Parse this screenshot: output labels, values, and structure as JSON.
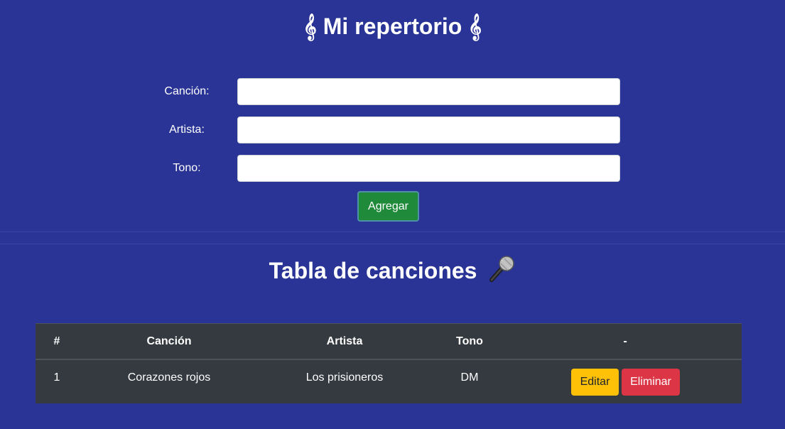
{
  "header": {
    "title": "𝄞 Mi repertorio 𝄞"
  },
  "form": {
    "song_label": "Canción:",
    "song_value": "",
    "artist_label": "Artista:",
    "artist_value": "",
    "key_label": "Tono:",
    "key_value": "",
    "add_button": "Agregar"
  },
  "table_section": {
    "title": "Tabla de canciones",
    "title_icon": "microphone-icon",
    "columns": [
      "#",
      "Canción",
      "Artista",
      "Tono",
      "-"
    ],
    "rows": [
      {
        "num": "1",
        "song": "Corazones rojos",
        "artist": "Los prisioneros",
        "key": "DM",
        "edit_label": "Editar",
        "delete_label": "Eliminar"
      }
    ]
  },
  "colors": {
    "background": "#293496",
    "add_button": "#1f8a3a",
    "edit_button": "#ffc107",
    "delete_button": "#dc3545",
    "table_bg": "#343a40"
  }
}
